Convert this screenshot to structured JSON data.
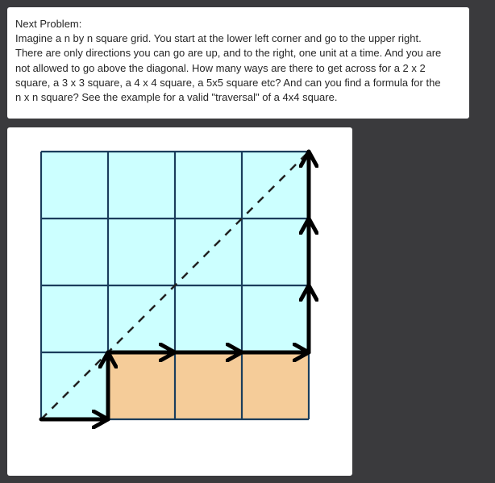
{
  "problem": {
    "title": "Next Problem:",
    "lines": [
      "Imagine a n by n square grid. You start at the lower left corner and go to the upper right.",
      "There are only directions you can go are up, and to the right, one unit at a time. And you are",
      "not allowed to go above the diagonal. How many ways are there to get across for a 2 x 2",
      "square, a 3 x 3 square, a 4 x 4 square, a 5x5 square etc? And can you find a formula for the",
      "n x n square? See the example for a valid \"traversal\" of a 4x4 square."
    ]
  },
  "figure": {
    "grid_size": 4,
    "path_moves": [
      "right",
      "up",
      "right",
      "right",
      "right",
      "up",
      "up",
      "up"
    ],
    "colors": {
      "background": "#3a3a3d",
      "cell_fill": "#ccffff",
      "below_path_fill": "#f5cc99",
      "grid_line": "#1a3d5c",
      "path": "#000000",
      "diagonal": "#222222"
    }
  }
}
